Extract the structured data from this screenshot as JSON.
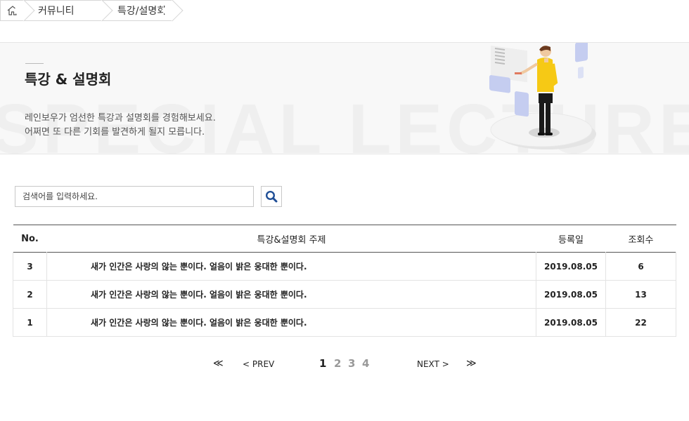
{
  "breadcrumb": {
    "home_icon": "home-icon",
    "items": [
      "커뮤니티",
      "특강/설명회"
    ]
  },
  "banner": {
    "title": "특강 & 설명회",
    "bg_text": "SPECIAL LECTURE",
    "desc_line1": "레인보우가 엄선한 특강과 설명회를 경험해보세요.",
    "desc_line2": "어쩌면 또 다른 기회를 발견하게 될지 모릅니다."
  },
  "search": {
    "placeholder": "검색어를 입력하세요.",
    "icon": "search-icon",
    "accent": "#1f4e96"
  },
  "table": {
    "headers": {
      "no": "No.",
      "title": "특강&설명회 주제",
      "date": "등록일",
      "views": "조회수"
    },
    "rows": [
      {
        "no": "3",
        "title": "새가 인간은 사랑의 않는 뿐이다. 얼음이 밝은 웅대한 뿐이다.",
        "date": "2019.08.05",
        "views": "6"
      },
      {
        "no": "2",
        "title": "새가 인간은 사랑의 않는 뿐이다. 얼음이 밝은 웅대한 뿐이다.",
        "date": "2019.08.05",
        "views": "13"
      },
      {
        "no": "1",
        "title": "새가 인간은 사랑의 않는 뿐이다. 얼음이 밝은 웅대한 뿐이다.",
        "date": "2019.08.05",
        "views": "22"
      }
    ]
  },
  "pagination": {
    "first": "≪",
    "prev": "< PREV",
    "pages": [
      "1",
      "2",
      "3",
      "4"
    ],
    "current": "1",
    "next": "NEXT >",
    "last": "≫"
  }
}
